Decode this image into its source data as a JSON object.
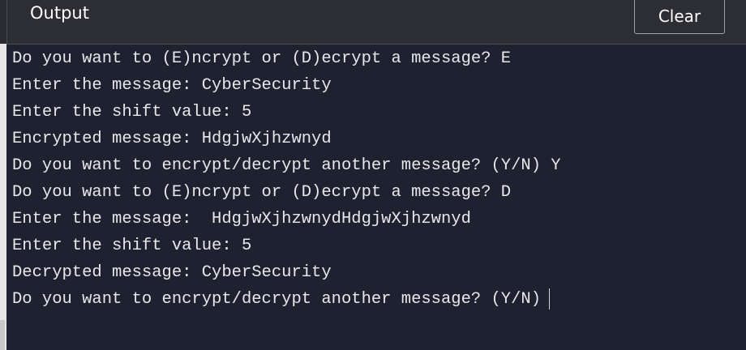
{
  "header": {
    "title": "Output",
    "clear_label": "Clear"
  },
  "terminal": {
    "lines": [
      "Do you want to (E)ncrypt or (D)ecrypt a message? E",
      "Enter the message: CyberSecurity",
      "Enter the shift value: 5",
      "Encrypted message: HdgjwXjhzwnyd",
      "Do you want to encrypt/decrypt another message? (Y/N) Y",
      "Do you want to (E)ncrypt or (D)ecrypt a message? D",
      "Enter the message:  HdgjwXjhzwnydHdgjwXjhzwnyd",
      "Enter the shift value: 5",
      "Decrypted message: CyberSecurity",
      "Do you want to encrypt/decrypt another message? (Y/N)"
    ]
  }
}
